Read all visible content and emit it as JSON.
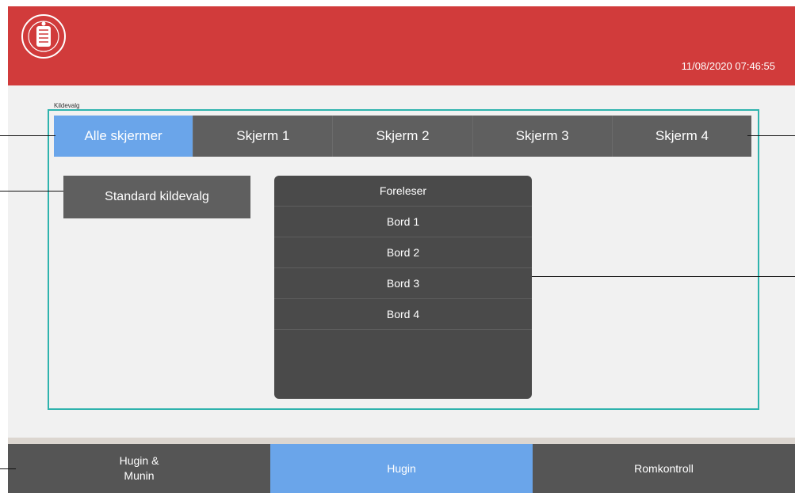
{
  "header": {
    "datetime": "11/08/2020 07:46:55",
    "logo_icon": "university-seal-icon",
    "background_color": "#d13b3b"
  },
  "source_group": {
    "legend": "Kildevalg",
    "border_color": "#2fb3ad"
  },
  "screen_tabs": [
    {
      "label": "Alle skjermer",
      "active": true
    },
    {
      "label": "Skjerm 1",
      "active": false
    },
    {
      "label": "Skjerm 2",
      "active": false
    },
    {
      "label": "Skjerm 3",
      "active": false
    },
    {
      "label": "Skjerm 4",
      "active": false
    }
  ],
  "standard_button": {
    "label": "Standard kildevalg"
  },
  "sources": [
    {
      "label": "Foreleser"
    },
    {
      "label": "Bord 1"
    },
    {
      "label": "Bord 2"
    },
    {
      "label": "Bord 3"
    },
    {
      "label": "Bord 4"
    }
  ],
  "footer_tabs": [
    {
      "label": "Hugin &\nMunin",
      "active": false
    },
    {
      "label": "Hugin",
      "active": true
    },
    {
      "label": "Romkontroll",
      "active": false
    }
  ],
  "colors": {
    "accent": "#6aa5ea",
    "button_gray": "#5f5f5f",
    "list_bg": "#4a4a4a"
  }
}
